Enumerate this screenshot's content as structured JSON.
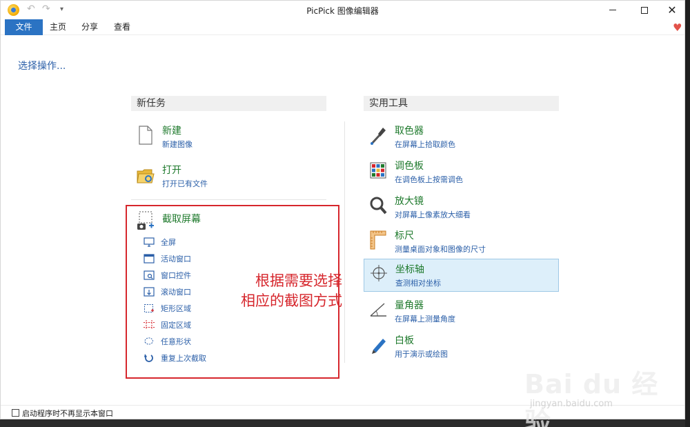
{
  "window": {
    "title": "PicPick 图像编辑器"
  },
  "tabs": [
    {
      "label": "文件"
    },
    {
      "label": "主页"
    },
    {
      "label": "分享"
    },
    {
      "label": "查看"
    }
  ],
  "select_operation": "选择操作...",
  "new_task": {
    "header": "新任务",
    "items": [
      {
        "title": "新建",
        "desc": "新建图像",
        "icon": "document-icon"
      },
      {
        "title": "打开",
        "desc": "打开已有文件",
        "icon": "folder-icon"
      },
      {
        "title": "截取屏幕",
        "icon": "camera-capture-icon"
      }
    ],
    "capture_options": [
      {
        "label": "全屏",
        "icon": "monitor-icon"
      },
      {
        "label": "活动窗口",
        "icon": "window-icon"
      },
      {
        "label": "窗口控件",
        "icon": "window-control-icon"
      },
      {
        "label": "滚动窗口",
        "icon": "scroll-window-icon"
      },
      {
        "label": "矩形区域",
        "icon": "rectangle-region-icon"
      },
      {
        "label": "固定区域",
        "icon": "fixed-region-icon"
      },
      {
        "label": "任意形状",
        "icon": "freeform-icon"
      },
      {
        "label": "重复上次截取",
        "icon": "repeat-icon"
      }
    ]
  },
  "tools": {
    "header": "实用工具",
    "items": [
      {
        "title": "取色器",
        "desc": "在屏幕上拾取颜色",
        "icon": "eyedropper-icon"
      },
      {
        "title": "调色板",
        "desc": "在调色板上按需调色",
        "icon": "palette-icon"
      },
      {
        "title": "放大镜",
        "desc": "对屏幕上像素放大细看",
        "icon": "magnifier-icon"
      },
      {
        "title": "标尺",
        "desc": "测量桌面对象和图像的尺寸",
        "icon": "ruler-icon"
      },
      {
        "title": "坐标轴",
        "desc": "查测相对坐标",
        "icon": "crosshair-icon"
      },
      {
        "title": "量角器",
        "desc": "在屏幕上测量角度",
        "icon": "protractor-icon"
      },
      {
        "title": "白板",
        "desc": "用于演示或绘图",
        "icon": "pen-icon"
      }
    ]
  },
  "annotation": {
    "line1": "根据需要选择",
    "line2": "相应的截图方式"
  },
  "footer": {
    "checkbox_label": "启动程序时不再显示本窗口"
  },
  "watermark": {
    "main": "Bai du 经验",
    "sub": "jingyan.baidu.com"
  },
  "colors": {
    "accent": "#2b73c3",
    "title_green": "#1f7a2d",
    "link_blue": "#2b5fa8",
    "annotation_red": "#d6262c",
    "selected_bg": "#ddeffa"
  }
}
